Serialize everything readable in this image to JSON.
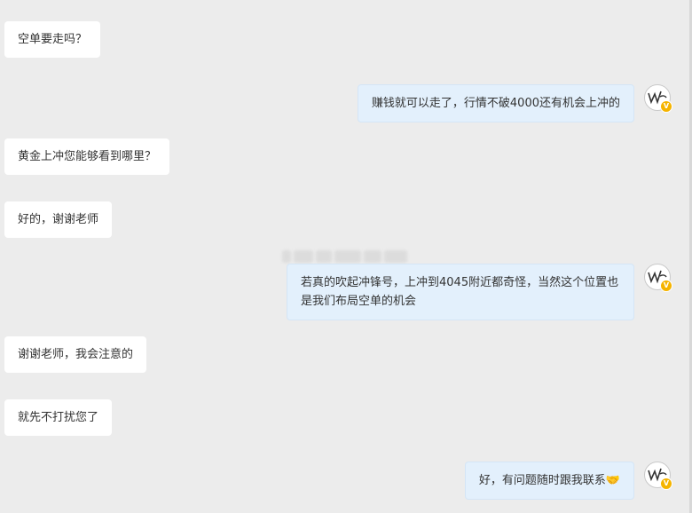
{
  "messages": [
    {
      "text": "空单要走吗？",
      "side": "in"
    },
    {
      "text": "赚钱就可以走了，行情不破4000还有机会上冲的",
      "side": "out"
    },
    {
      "text": "黄金上冲您能够看到哪里？",
      "side": "in"
    },
    {
      "text": "好的，谢谢老师",
      "side": "in"
    },
    {
      "text": "若真的吹起冲锋号，上冲到4045附近都奇怪，当然这个位置也是我们布局空单的机会",
      "side": "out"
    },
    {
      "text": "谢谢老师，我会注意的",
      "side": "in"
    },
    {
      "text": "就先不打扰您了",
      "side": "in"
    },
    {
      "text": "好，有问题随时跟我联系🤝",
      "side": "out"
    }
  ],
  "avatar": {
    "icon": "signature-logo-icon",
    "badge": "V",
    "badge_color": "#f5b400"
  },
  "colors": {
    "background": "#ececec",
    "incoming": "#ffffff",
    "outgoing": "#e3f0fc"
  }
}
